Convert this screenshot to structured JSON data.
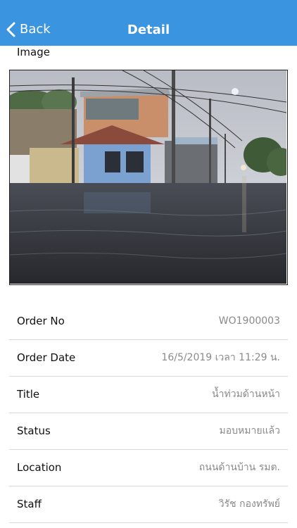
{
  "navbar": {
    "back_label": "Back",
    "title": "Detail",
    "background_color": "#3a94df"
  },
  "image_section": {
    "label": "Image",
    "photo_subject": "flooded street with house and power poles"
  },
  "details": [
    {
      "label": "Order No",
      "value": "WO1900003"
    },
    {
      "label": "Order Date",
      "value": "16/5/2019 เวลา 11:29 น."
    },
    {
      "label": "Title",
      "value": "น้ำท่วมด้านหน้า"
    },
    {
      "label": "Status",
      "value": "มอบหมายแล้ว"
    },
    {
      "label": "Location",
      "value": "ถนนด้านบ้าน รมต."
    },
    {
      "label": "Staff",
      "value": "วิรัช กองทรัพย์"
    }
  ]
}
